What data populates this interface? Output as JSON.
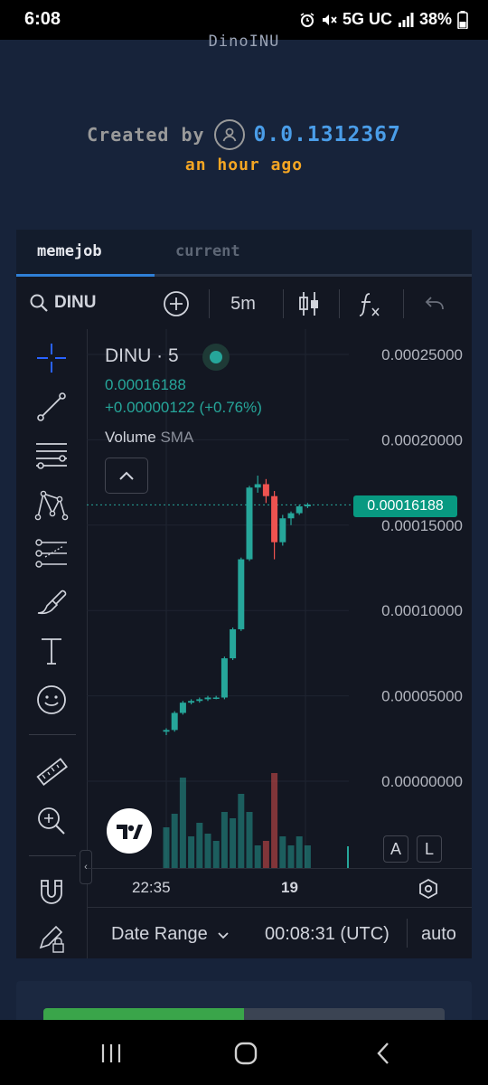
{
  "status": {
    "time": "6:08",
    "network": "5G UC",
    "battery": "38%",
    "icons": [
      "alarm-icon",
      "mute-icon",
      "signal-icon",
      "battery-icon"
    ]
  },
  "token": {
    "name": "DinoINU",
    "created_by_label": "Created by",
    "creator_id": "0.0.1312367",
    "created_time": "an hour ago"
  },
  "tabs": [
    {
      "label": "memejob",
      "active": true
    },
    {
      "label": "current",
      "active": false
    }
  ],
  "toolbar": {
    "symbol": "DINU",
    "interval": "5m",
    "icons": [
      "search-icon",
      "add-symbol-icon",
      "candles-icon",
      "indicators-icon",
      "undo-icon"
    ]
  },
  "left_tools": [
    "crosshair-icon",
    "trend-line-icon",
    "fib-icon",
    "pattern-icon",
    "prediction-icon",
    "brush-icon",
    "text-icon",
    "emoji-icon",
    "ruler-icon",
    "zoom-icon",
    "magnet-icon",
    "lock-drawing-icon"
  ],
  "legend": {
    "title": "DINU · 5",
    "price": "0.00016188",
    "change": "+0.00000122 (+0.76%)",
    "volume_label": "Volume",
    "sma_label": "SMA"
  },
  "price_label": "0.00016188",
  "scale_buttons": [
    "A",
    "L"
  ],
  "bottom": {
    "date_range": "Date Range",
    "clock": "00:08:31 (UTC)",
    "mode": "auto"
  },
  "progress": {
    "fraction": 0.5
  },
  "colors": {
    "up": "#26a69a",
    "down": "#ef5350",
    "accent": "#2f7fd6",
    "creator": "#4a9de8",
    "time": "#f5a623"
  },
  "chart_data": {
    "type": "candlestick",
    "ylim": [
      0,
      0.00025
    ],
    "yticks": [
      "0.00025000",
      "0.00020000",
      "0.00015000",
      "0.00010000",
      "0.00005000",
      "0.00000000"
    ],
    "xticks": [
      "22:35",
      "19"
    ],
    "last_price": 0.00016188,
    "candles": [
      {
        "o": 2.9e-05,
        "h": 3.1e-05,
        "l": 2.7e-05,
        "c": 3e-05
      },
      {
        "o": 3e-05,
        "h": 4.1e-05,
        "l": 2.9e-05,
        "c": 4e-05
      },
      {
        "o": 4e-05,
        "h": 4.7e-05,
        "l": 3.9e-05,
        "c": 4.6e-05
      },
      {
        "o": 4.6e-05,
        "h": 4.8e-05,
        "l": 4.5e-05,
        "c": 4.7e-05
      },
      {
        "o": 4.7e-05,
        "h": 4.9e-05,
        "l": 4.6e-05,
        "c": 4.8e-05
      },
      {
        "o": 4.8e-05,
        "h": 5e-05,
        "l": 4.7e-05,
        "c": 4.9e-05
      },
      {
        "o": 4.9e-05,
        "h": 5e-05,
        "l": 4.8e-05,
        "c": 4.9e-05
      },
      {
        "o": 4.9e-05,
        "h": 7.3e-05,
        "l": 4.8e-05,
        "c": 7.2e-05
      },
      {
        "o": 7.2e-05,
        "h": 9e-05,
        "l": 7.1e-05,
        "c": 8.9e-05
      },
      {
        "o": 8.9e-05,
        "h": 0.000131,
        "l": 8.8e-05,
        "c": 0.00013
      },
      {
        "o": 0.00013,
        "h": 0.000173,
        "l": 0.000129,
        "c": 0.000172
      },
      {
        "o": 0.000172,
        "h": 0.000179,
        "l": 0.000169,
        "c": 0.000174
      },
      {
        "o": 0.000174,
        "h": 0.000177,
        "l": 0.000163,
        "c": 0.000167
      },
      {
        "o": 0.000167,
        "h": 0.00017,
        "l": 0.00013,
        "c": 0.00014
      },
      {
        "o": 0.00014,
        "h": 0.000156,
        "l": 0.000138,
        "c": 0.000154
      },
      {
        "o": 0.000154,
        "h": 0.000158,
        "l": 0.00015,
        "c": 0.000157
      },
      {
        "o": 0.000157,
        "h": 0.000162,
        "l": 0.000156,
        "c": 0.000161
      },
      {
        "o": 0.000161,
        "h": 0.000163,
        "l": 0.00016,
        "c": 0.000162
      }
    ],
    "volume": [
      0.45,
      0.6,
      1.0,
      0.35,
      0.5,
      0.38,
      0.3,
      0.62,
      0.55,
      0.82,
      0.62,
      0.25,
      0.3,
      1.05,
      0.35,
      0.25,
      0.35,
      0.25
    ]
  }
}
